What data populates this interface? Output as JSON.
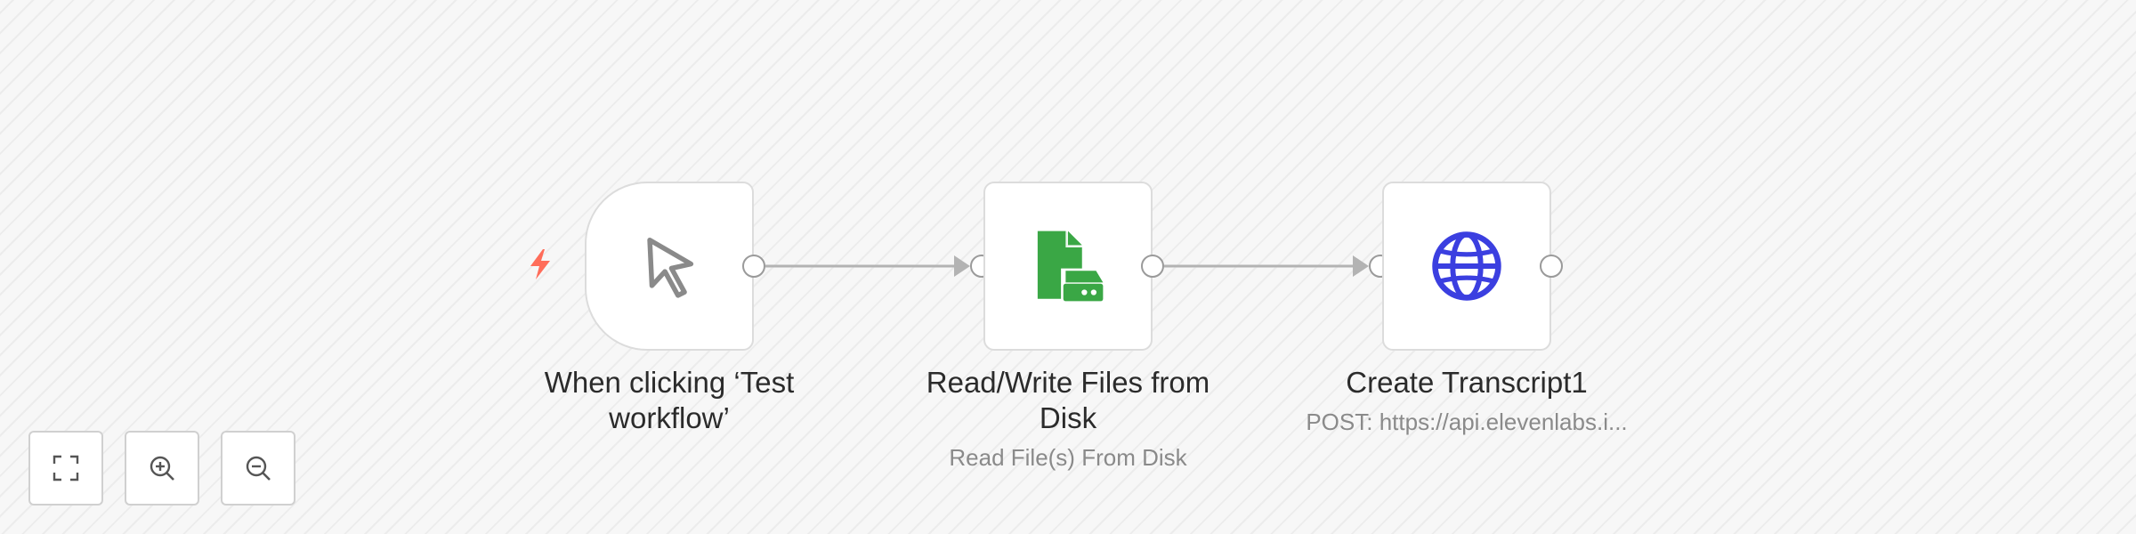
{
  "nodes": [
    {
      "label_line1": "When clicking ‘Test",
      "label_line2": "workflow’",
      "icon": "cursor-icon"
    },
    {
      "label_line1": "Read/Write Files from",
      "label_line2": "Disk",
      "subtitle": "Read File(s) From Disk",
      "icon": "file-disk-icon"
    },
    {
      "label_line1": "Create Transcript1",
      "subtitle": "POST: https://api.elevenlabs.i...",
      "icon": "globe-icon"
    }
  ],
  "controls": {
    "fit": "fit-view",
    "zoom_in": "zoom-in",
    "zoom_out": "zoom-out"
  },
  "colors": {
    "trigger_bolt": "#ff6d5a",
    "file_icon": "#3aa745",
    "globe_icon": "#3b3fe0",
    "cursor_icon": "#8a8a8a"
  }
}
